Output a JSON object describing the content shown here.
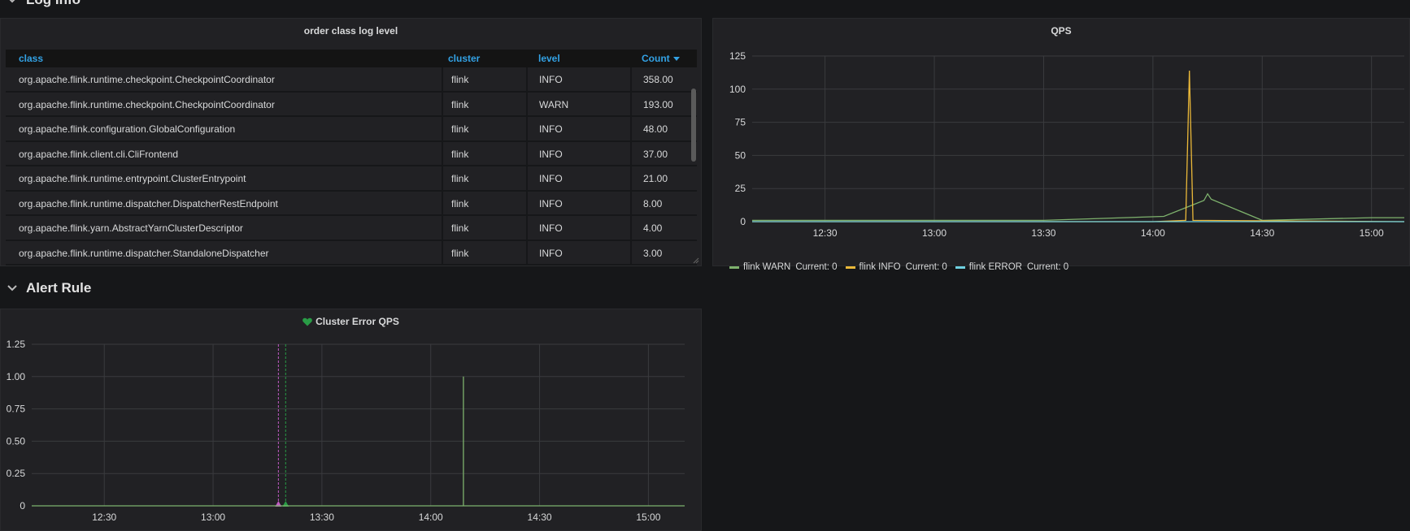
{
  "rows": {
    "log_info": "Log Info",
    "alert_rule": "Alert Rule"
  },
  "table_panel": {
    "title": "order class log level",
    "columns": [
      "class",
      "cluster",
      "level",
      "Count"
    ],
    "sort_column": "Count",
    "rows": [
      [
        "org.apache.flink.runtime.checkpoint.CheckpointCoordinator",
        "flink",
        "INFO",
        "358.00"
      ],
      [
        "org.apache.flink.runtime.checkpoint.CheckpointCoordinator",
        "flink",
        "WARN",
        "193.00"
      ],
      [
        "org.apache.flink.configuration.GlobalConfiguration",
        "flink",
        "INFO",
        "48.00"
      ],
      [
        "org.apache.flink.client.cli.CliFrontend",
        "flink",
        "INFO",
        "37.00"
      ],
      [
        "org.apache.flink.runtime.entrypoint.ClusterEntrypoint",
        "flink",
        "INFO",
        "21.00"
      ],
      [
        "org.apache.flink.runtime.dispatcher.DispatcherRestEndpoint",
        "flink",
        "INFO",
        "8.00"
      ],
      [
        "org.apache.flink.yarn.AbstractYarnClusterDescriptor",
        "flink",
        "INFO",
        "4.00"
      ],
      [
        "org.apache.flink.runtime.dispatcher.StandaloneDispatcher",
        "flink",
        "INFO",
        "3.00"
      ]
    ]
  },
  "qps_panel": {
    "title": "QPS",
    "legend": [
      {
        "name": "flink WARN",
        "current_label": "Current:",
        "current": "0",
        "color": "#7eb26d"
      },
      {
        "name": "flink INFO",
        "current_label": "Current:",
        "current": "0",
        "color": "#eab839"
      },
      {
        "name": "flink ERROR",
        "current_label": "Current:",
        "current": "0",
        "color": "#6ed0e0"
      }
    ]
  },
  "alert_panel": {
    "title": "Cluster Error QPS",
    "heart_color": "#299c46"
  },
  "colors": {
    "background": "#161719",
    "panel": "#212124",
    "accent": "#33a2e5",
    "grid": "#3a3b3e",
    "warn": "#7eb26d",
    "info": "#eab839",
    "error": "#6ed0e0",
    "alert_ok": "#299c46",
    "alert_pending": "#c15cc4"
  },
  "chart_data": [
    {
      "type": "line",
      "title": "QPS",
      "xlabel": "",
      "ylabel": "",
      "x_ticks": [
        "12:30",
        "13:00",
        "13:30",
        "14:00",
        "14:30",
        "15:00"
      ],
      "y_ticks": [
        "0",
        "25",
        "50",
        "75",
        "100",
        "125"
      ],
      "ylim": [
        0,
        125
      ],
      "xlim": [
        "12:10",
        "15:09"
      ],
      "grid": true,
      "legend_position": "bottom-left",
      "series": [
        {
          "name": "flink WARN",
          "color": "#7eb26d",
          "x": [
            "12:10",
            "13:30",
            "14:03",
            "14:14",
            "14:15",
            "14:16",
            "14:30",
            "15:00",
            "15:09"
          ],
          "values": [
            1,
            1,
            4,
            16,
            21,
            17,
            1,
            3,
            3
          ]
        },
        {
          "name": "flink INFO",
          "color": "#eab839",
          "x": [
            "12:10",
            "14:00",
            "14:09",
            "14:10",
            "14:11",
            "15:09"
          ],
          "values": [
            0,
            0,
            1,
            114,
            1,
            0
          ]
        },
        {
          "name": "flink ERROR",
          "color": "#6ed0e0",
          "x": [
            "12:10",
            "15:09"
          ],
          "values": [
            0,
            0
          ]
        }
      ]
    },
    {
      "type": "line",
      "title": "Cluster Error QPS",
      "xlabel": "",
      "ylabel": "",
      "x_ticks": [
        "12:30",
        "13:00",
        "13:30",
        "14:00",
        "14:30",
        "15:00"
      ],
      "y_ticks": [
        "0",
        "0.25",
        "0.50",
        "0.75",
        "1.00",
        "1.25"
      ],
      "ylim": [
        0,
        1.25
      ],
      "xlim": [
        "12:10",
        "15:10"
      ],
      "grid": true,
      "series": [
        {
          "name": "",
          "color": "#7eb26d",
          "x": [
            "12:10",
            "14:09",
            "14:09",
            "14:09",
            "15:10"
          ],
          "values": [
            0,
            0,
            1,
            0,
            0
          ]
        }
      ],
      "annotations": [
        {
          "type": "alert_pending",
          "x": "13:18",
          "color": "#c15cc4"
        },
        {
          "type": "alert_ok",
          "x": "13:20",
          "color": "#299c46"
        }
      ]
    }
  ]
}
